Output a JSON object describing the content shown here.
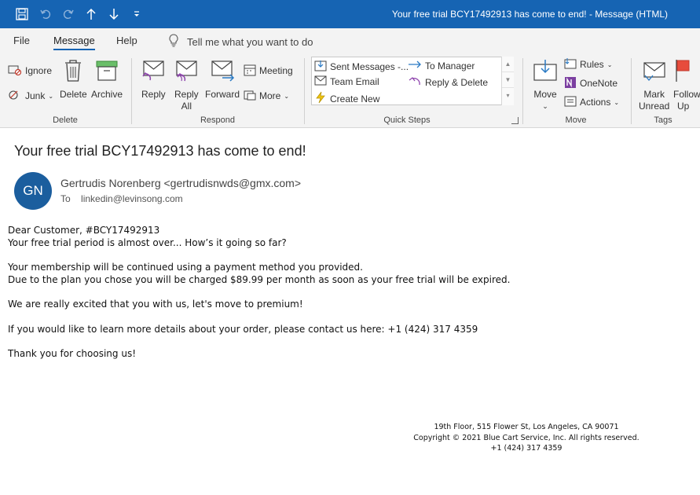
{
  "window": {
    "title": "Your free trial BCY17492913 has come to end!  -  Message (HTML)"
  },
  "menu": {
    "file": "File",
    "message": "Message",
    "help": "Help",
    "tell_me": "Tell me what you want to do"
  },
  "ribbon": {
    "delete_group": {
      "label": "Delete",
      "ignore": "Ignore",
      "junk": "Junk",
      "delete": "Delete",
      "archive": "Archive"
    },
    "respond_group": {
      "label": "Respond",
      "reply": "Reply",
      "reply_all_1": "Reply",
      "reply_all_2": "All",
      "forward": "Forward",
      "meeting": "Meeting",
      "more": "More"
    },
    "quick_steps_group": {
      "label": "Quick Steps",
      "items": [
        "Sent Messages -...",
        "Team Email",
        "Create New",
        "To Manager",
        "Reply & Delete"
      ]
    },
    "move_group": {
      "label": "Move",
      "move": "Move",
      "rules": "Rules",
      "onenote": "OneNote",
      "actions": "Actions"
    },
    "tags_group": {
      "label": "Tags",
      "mark_unread_1": "Mark",
      "mark_unread_2": "Unread",
      "follow_up_1": "Follow",
      "follow_up_2": "Up"
    }
  },
  "message": {
    "subject": "Your free trial BCY17492913 has come to end!",
    "avatar_initials": "GN",
    "sender": "Gertrudis Norenberg <gertrudisnwds@gmx.com>",
    "to_label": "To",
    "to": "linkedin@levinsong.com",
    "body": {
      "line1": "Dear Customer, #BCY17492913",
      "line2": "Your free trial period is almost over... How’s it going so far?",
      "line3": "Your membership will be continued using a payment method you provided.",
      "line4": "Due to the plan you chose you will be charged $89.99 per month as soon as your free trial will be expired.",
      "line5": "We are really excited that you with us, let's move to premium!",
      "line6": "If you would like to learn more details about your order, please contact us here: +1 (424) 317 4359",
      "line7": "Thank you for choosing us!"
    },
    "footer": {
      "address": "19th Floor, 515 Flower St, Los Angeles, CA 90071",
      "copyright": "Copyright © 2021 Blue Cart Service, Inc. All rights reserved.",
      "phone": "+1 (424) 317 4359"
    }
  },
  "colors": {
    "titlebar": "#1664b3",
    "avatar": "#1b5e9e",
    "ribbon_bg": "#f3f3f3"
  }
}
